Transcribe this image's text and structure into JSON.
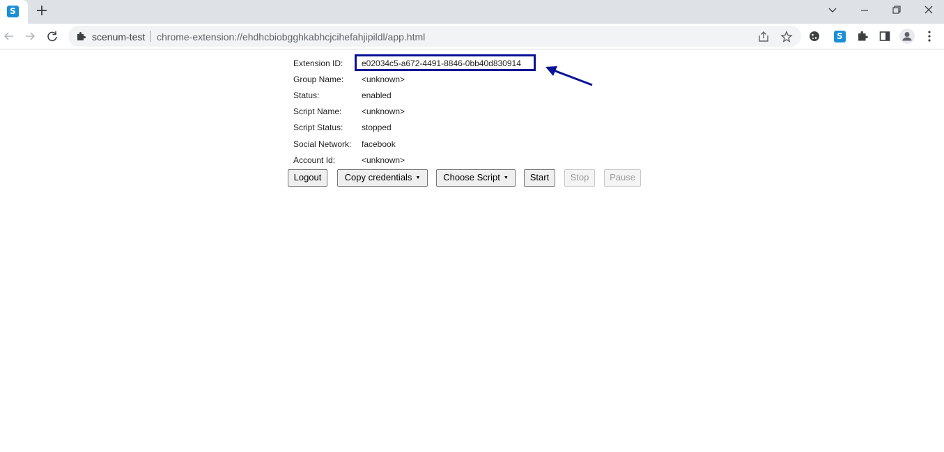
{
  "browser": {
    "tab": {
      "favicon_letter": "S",
      "favicon_color": "#1a8fd6"
    },
    "new_tab_symbol": "+",
    "site_name": "scenum-test",
    "url": "chrome-extension://ehdhcbiobgghkabhcjcihefahjipildl/app.html",
    "extension_letter": "S",
    "icons": [
      "back-icon",
      "forward-icon",
      "reload-icon",
      "puzzle-icon",
      "share-icon",
      "star-icon",
      "cookie-icon",
      "extensions-icon",
      "side-panel-icon",
      "profile-icon",
      "more-icon",
      "tab-search-icon",
      "minimize-icon",
      "restore-icon",
      "close-icon"
    ]
  },
  "app": {
    "extension_id": {
      "label": "Extension ID:",
      "value": "e02034c5-a672-4491-8846-0bb40d830914"
    },
    "rows": [
      {
        "label": "Group Name:",
        "value": "<unknown>"
      },
      {
        "label": "Status:",
        "value": "enabled"
      },
      {
        "label": "Script Name:",
        "value": "<unknown>"
      },
      {
        "label": "Script Status:",
        "value": "stopped"
      },
      {
        "label": "Social Network:",
        "value": "facebook"
      },
      {
        "label": "Account Id:",
        "value": "<unknown>"
      }
    ],
    "buttons": {
      "logout": "Logout",
      "copy_credentials": "Copy credentials",
      "choose_script": "Choose Script",
      "start": "Start",
      "stop": "Stop",
      "pause": "Pause",
      "caret": "▼"
    },
    "highlight_color": "#0a1296"
  }
}
